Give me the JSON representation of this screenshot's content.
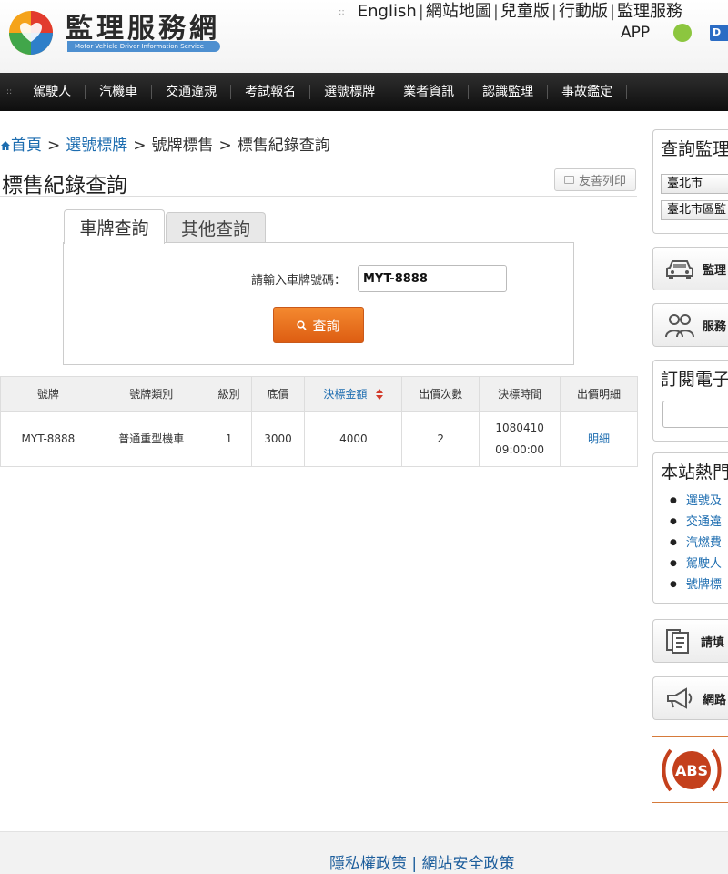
{
  "header": {
    "site_title": "監理服務網",
    "tagline": "Motor Vehicle Driver Information Service",
    "top_links": [
      "English",
      "網站地圖",
      "兒童版",
      "行動版",
      "監理服務"
    ],
    "app_label": "APP",
    "blue_badge": "D"
  },
  "nav": {
    "items": [
      "駕駛人",
      "汽機車",
      "交通違規",
      "考試報名",
      "選號標牌",
      "業者資訊",
      "認識監理",
      "事故鑑定"
    ]
  },
  "breadcrumb": {
    "home": "首頁",
    "plate_selection": "選號標牌",
    "plate_auction": "號牌標售",
    "current": "標售紀錄查詢"
  },
  "page": {
    "title": "標售紀錄查詢",
    "print_label": "友善列印"
  },
  "tabs": {
    "plate": "車牌查詢",
    "other": "其他查詢"
  },
  "search": {
    "label": "請輸入車牌號碼：",
    "value": "MYT-8888",
    "button_label": "查詢"
  },
  "table": {
    "headers": [
      "號牌",
      "號牌類別",
      "級別",
      "底價",
      "決標金額",
      "出價次數",
      "決標時間",
      "出價明細"
    ],
    "rows": [
      {
        "plate": "MYT-8888",
        "category": "普通重型機車",
        "level": "1",
        "base_price": "3000",
        "winning_bid": "4000",
        "bid_count": "2",
        "date": "1080410",
        "time": "09:00:00",
        "detail": "明細"
      }
    ]
  },
  "sidebar": {
    "query_title": "查詢監理",
    "city_select": "臺北市",
    "office_select": "臺北市區監",
    "btn_office": "監理",
    "btn_service": "服務",
    "subscribe_title": "訂閱電子",
    "hot_title": "本站熱門",
    "hot_items": [
      "選號及",
      "交通違",
      "汽燃費",
      "駕駛人",
      "號牌標"
    ],
    "btn_form": "請填",
    "btn_network": "網路",
    "abs_label": "ABS"
  },
  "footer": {
    "privacy": "隱私權政策",
    "security": "網站安全政策"
  },
  "colors": {
    "link": "#1d6db0",
    "nav_bg": "#1a1a1a",
    "button_orange": "#e8701f",
    "abs_red": "#c4401c"
  }
}
